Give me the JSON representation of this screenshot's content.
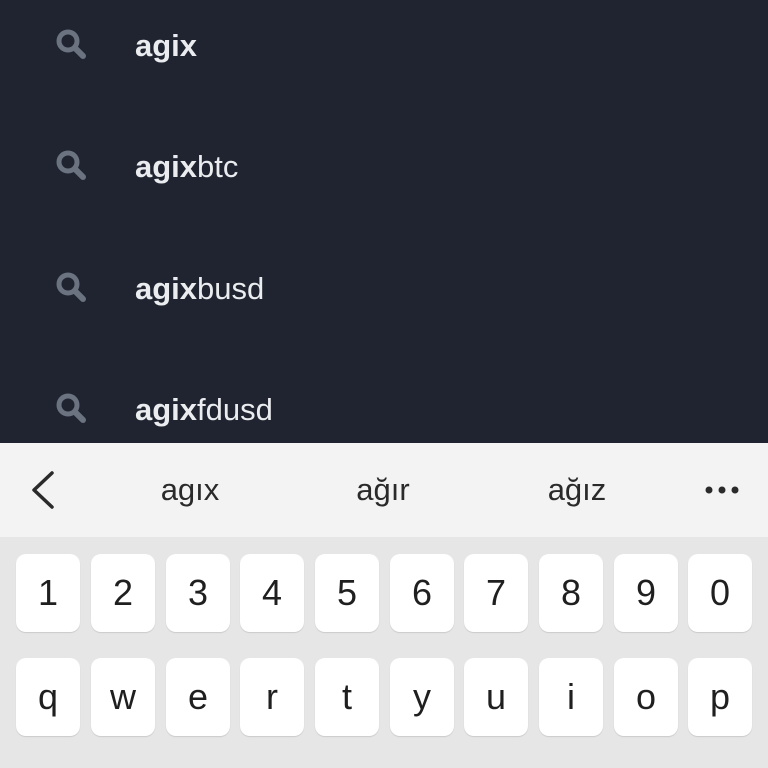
{
  "suggestions": [
    {
      "prefix": "agix",
      "suffix": ""
    },
    {
      "prefix": "agix",
      "suffix": "btc"
    },
    {
      "prefix": "agix",
      "suffix": "busd"
    },
    {
      "prefix": "agix",
      "suffix": "fdusd"
    }
  ],
  "icons": {
    "suggestion": "search-icon",
    "back": "chevron-left-icon",
    "more": "more-dots-icon"
  },
  "toolbar": {
    "words": [
      "agıx",
      "ağır",
      "ağız"
    ]
  },
  "keyboard": {
    "row1": [
      "1",
      "2",
      "3",
      "4",
      "5",
      "6",
      "7",
      "8",
      "9",
      "0"
    ],
    "row2": [
      "q",
      "w",
      "e",
      "r",
      "t",
      "y",
      "u",
      "i",
      "o",
      "p"
    ]
  },
  "colors": {
    "list_bg": "#1f2430",
    "suggestion_text": "#eaecef",
    "icon": "#6b7280",
    "toolbar_bg": "#f3f3f3",
    "keyboard_bg": "#e6e6e6",
    "key_bg": "#ffffff"
  }
}
